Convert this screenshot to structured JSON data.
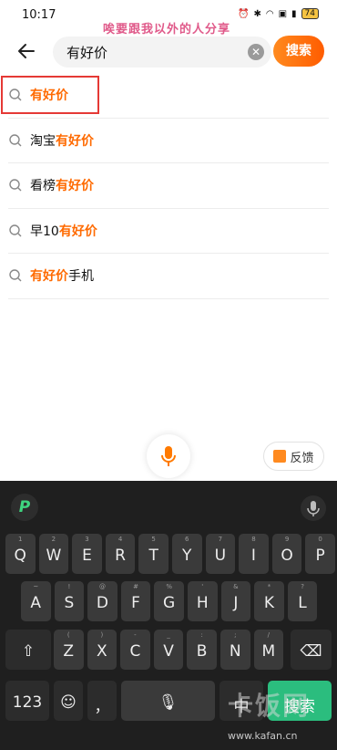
{
  "status": {
    "time": "10:17",
    "overlay": "唉要跟我以外的人分享",
    "battery": "74"
  },
  "search": {
    "value": "有好价",
    "button_label": "搜索"
  },
  "suggestions": [
    {
      "prefix": "",
      "highlight": "有好价",
      "suffix": ""
    },
    {
      "prefix": "淘宝",
      "highlight": "有好价",
      "suffix": ""
    },
    {
      "prefix": "看榜",
      "highlight": "有好价",
      "suffix": ""
    },
    {
      "prefix": "早10",
      "highlight": "有好价",
      "suffix": ""
    },
    {
      "prefix": "",
      "highlight": "有好价",
      "suffix": "手机"
    }
  ],
  "feedback_label": "反馈",
  "keyboard": {
    "row1": [
      [
        "Q",
        "1"
      ],
      [
        "W",
        "2"
      ],
      [
        "E",
        "3"
      ],
      [
        "R",
        "4"
      ],
      [
        "T",
        "5"
      ],
      [
        "Y",
        "6"
      ],
      [
        "U",
        "7"
      ],
      [
        "I",
        "8"
      ],
      [
        "O",
        "9"
      ],
      [
        "P",
        "0"
      ]
    ],
    "row2": [
      [
        "A",
        "~"
      ],
      [
        "S",
        "!"
      ],
      [
        "D",
        "@"
      ],
      [
        "F",
        "#"
      ],
      [
        "G",
        "%"
      ],
      [
        "H",
        "'"
      ],
      [
        "J",
        "&"
      ],
      [
        "K",
        "*"
      ],
      [
        "L",
        "?"
      ]
    ],
    "row3": [
      [
        "Z",
        "("
      ],
      [
        "X",
        ")"
      ],
      [
        "C",
        "-"
      ],
      [
        "V",
        "_"
      ],
      [
        "B",
        ":"
      ],
      [
        "N",
        ";"
      ],
      [
        "M",
        "/"
      ]
    ],
    "row2_subs": [
      "~",
      "!",
      "@",
      "#",
      "%",
      "'",
      "&",
      "*",
      "?"
    ],
    "k123": "123",
    "space_mic": "",
    "comma": "，",
    "lang": "中",
    "enter": "搜索"
  },
  "watermark": {
    "big": "卡饭网",
    "url": "www.kafan.cn"
  },
  "colors": {
    "accent": "#ff6a00",
    "keyboard_bg": "#1f1f1f",
    "key": "#3a3a3a",
    "enter": "#2bbd7e"
  }
}
